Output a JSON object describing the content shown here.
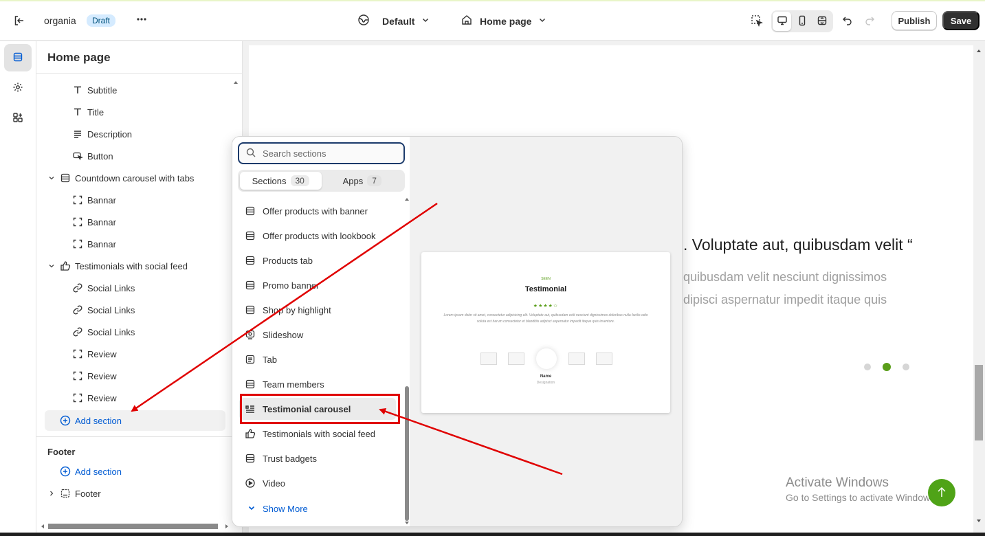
{
  "topbar": {
    "store_name": "organia",
    "status_badge": "Draft",
    "more_icon": "ellipsis-icon",
    "theme_selector": {
      "icon": "globe-icon",
      "label": "Default"
    },
    "page_selector": {
      "icon": "home-icon",
      "label": "Home page"
    },
    "publish_label": "Publish",
    "save_label": "Save"
  },
  "rail": {
    "items": [
      "sections-icon",
      "settings-icon",
      "apps-icon"
    ]
  },
  "sidebar": {
    "title": "Home page",
    "tree": [
      {
        "label": "Subtitle",
        "icon": "text-icon",
        "level": 2
      },
      {
        "label": "Title",
        "icon": "text-icon",
        "level": 2
      },
      {
        "label": "Description",
        "icon": "paragraph-icon",
        "level": 2
      },
      {
        "label": "Button",
        "icon": "button-icon",
        "level": 2
      },
      {
        "label": "Countdown carousel with tabs",
        "icon": "section-icon",
        "level": 1
      },
      {
        "label": "Bannar",
        "icon": "block-icon",
        "level": 2
      },
      {
        "label": "Bannar",
        "icon": "block-icon",
        "level": 2
      },
      {
        "label": "Bannar",
        "icon": "block-icon",
        "level": 2
      },
      {
        "label": "Testimonials with social feed",
        "icon": "thumbs-up-icon",
        "level": 1
      },
      {
        "label": "Social Links",
        "icon": "link-icon",
        "level": 2
      },
      {
        "label": "Social Links",
        "icon": "link-icon",
        "level": 2
      },
      {
        "label": "Social Links",
        "icon": "link-icon",
        "level": 2
      },
      {
        "label": "Review",
        "icon": "block-icon",
        "level": 2
      },
      {
        "label": "Review",
        "icon": "block-icon",
        "level": 2
      },
      {
        "label": "Review",
        "icon": "block-icon",
        "level": 2
      }
    ],
    "add_section_label": "Add section",
    "footer": {
      "title": "Footer",
      "add_section_label": "Add section",
      "footer_item_label": "Footer"
    }
  },
  "picker": {
    "search_placeholder": "Search sections",
    "tabs": [
      {
        "label": "Sections",
        "count": "30"
      },
      {
        "label": "Apps",
        "count": "7"
      }
    ],
    "items": [
      {
        "label": "Offer products with banner",
        "icon": "section-icon"
      },
      {
        "label": "Offer products with lookbook",
        "icon": "section-icon"
      },
      {
        "label": "Products tab",
        "icon": "section-icon"
      },
      {
        "label": "Promo banner",
        "icon": "section-icon"
      },
      {
        "label": "Shop by highlight",
        "icon": "section-icon"
      },
      {
        "label": "Slideshow",
        "icon": "slideshow-icon"
      },
      {
        "label": "Tab",
        "icon": "tab-icon"
      },
      {
        "label": "Team members",
        "icon": "section-icon"
      },
      {
        "label": "Testimonial carousel",
        "icon": "quote-list-icon",
        "selected": true
      },
      {
        "label": "Testimonials with social feed",
        "icon": "thumbs-up-icon"
      },
      {
        "label": "Trust badgets",
        "icon": "section-icon"
      },
      {
        "label": "Video",
        "icon": "play-icon"
      }
    ],
    "show_more_label": "Show More",
    "preview": {
      "tag": "SEEN",
      "title": "Testimonial",
      "stars": "★★★★☆",
      "body": "Lorem ipsum dolor sit amet, consectetur adipisicing elit. Voluptate aut, quibusdam velit nesciunt dignissimos doloribus nulla facilis odio soluta est harum consectetur et blanditiis adipisci aspernatur impedit itaque quis inventore.",
      "name": "Name",
      "designation": "Designation"
    }
  },
  "canvas": {
    "quote": ". Voluptate aut, quibusdam velit “",
    "line1": "quibusdam velit nesciunt dignissimos",
    "line2": "dipisci aspernatur impedit itaque quis",
    "watermark_title": "Activate Windows",
    "watermark_sub": "Go to Settings to activate Windows."
  },
  "colors": {
    "accent_blue": "#005bd3",
    "save_bg": "#303030",
    "annotation_red": "#e00000",
    "brand_green": "#5a9e1a"
  }
}
